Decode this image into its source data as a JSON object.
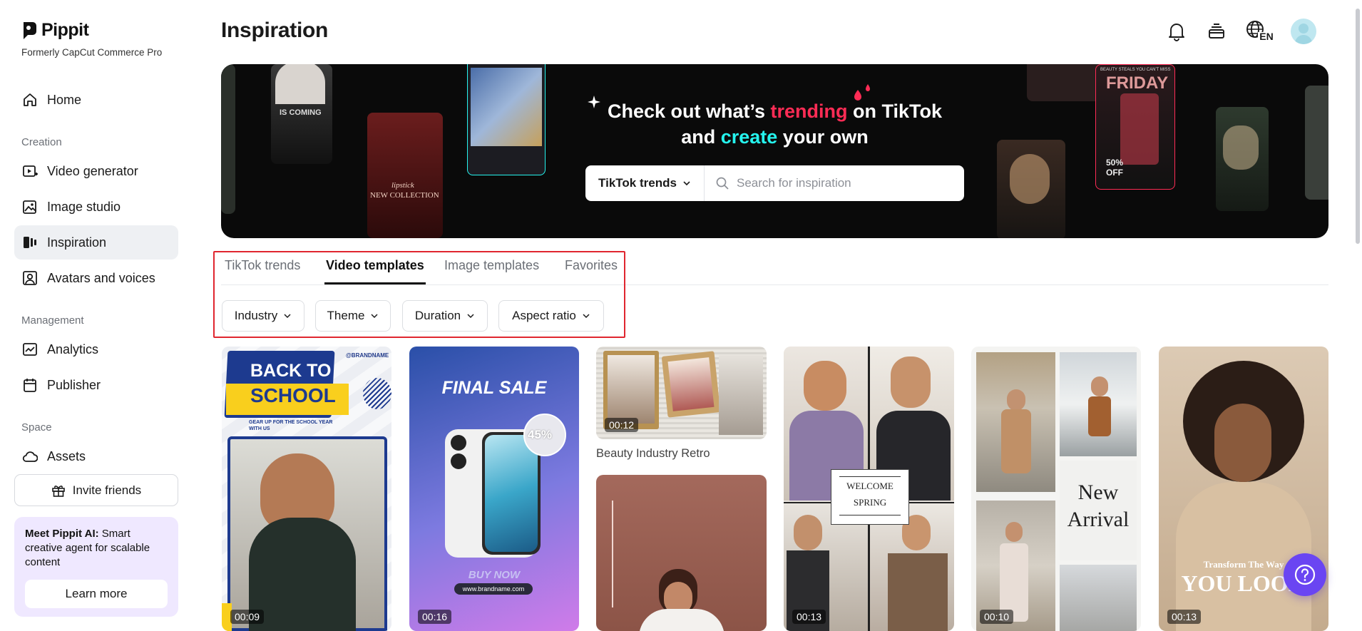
{
  "brand": {
    "name": "Pippit",
    "subtitle": "Formerly CapCut Commerce Pro"
  },
  "sidebar": {
    "home": "Home",
    "sections": {
      "creation": "Creation",
      "management": "Management",
      "space": "Space"
    },
    "items": [
      {
        "label": "Video generator",
        "icon": "video-plus-icon"
      },
      {
        "label": "Image studio",
        "icon": "image-edit-icon"
      },
      {
        "label": "Inspiration",
        "icon": "inspiration-icon",
        "active": true
      },
      {
        "label": "Avatars and voices",
        "icon": "avatar-icon"
      },
      {
        "label": "Analytics",
        "icon": "chart-icon"
      },
      {
        "label": "Publisher",
        "icon": "calendar-icon"
      },
      {
        "label": "Assets",
        "icon": "cloud-icon"
      }
    ],
    "invite": "Invite friends",
    "promo": {
      "bold": "Meet Pippit AI:",
      "text": " Smart creative agent for scalable content",
      "button": "Learn more"
    }
  },
  "header": {
    "title": "Inspiration",
    "icons": [
      "bell-icon",
      "layers-icon",
      "language-icon"
    ],
    "language": "EN"
  },
  "banner": {
    "line1_a": "Check out what’s ",
    "line1_pink": "trending",
    "line1_b": " on TikTok",
    "line2_a": "and ",
    "line2_cyan": "create",
    "line2_b": " your own",
    "select_value": "TikTok trends",
    "search_placeholder": "Search for inspiration",
    "thumb_texts": {
      "is_coming": "IS COMING",
      "lipstick": "lipstick",
      "new_collection": "NEW COLLECTION",
      "beauty_deals": "BEAUTY STEALS YOU CAN'T MISS",
      "friday": "FRIDAY",
      "off": "50%\nOFF"
    }
  },
  "tabs": [
    "TikTok trends",
    "Video templates",
    "Image templates",
    "Favorites"
  ],
  "active_tab": "Video templates",
  "filters": [
    "Industry",
    "Theme",
    "Duration",
    "Aspect ratio"
  ],
  "cards": [
    {
      "duration": "00:09",
      "texts": {
        "brandname": "@BRANDNAME",
        "back": "BACK TO",
        "school": "SCHOOL",
        "gear": "GEAR UP FOR THE SCHOOL YEAR WITH US"
      }
    },
    {
      "duration": "00:16",
      "texts": {
        "final": "FINAL SALE",
        "pct": "45%",
        "buy": "BUY NOW",
        "url": "www.brandname.com"
      }
    },
    {
      "duration": "00:12",
      "title": "Beauty Industry Retro"
    },
    {
      "duration": ""
    },
    {
      "duration": "00:13",
      "texts": {
        "welcome": "WELCOME",
        "spring": "SPRING"
      }
    },
    {
      "duration": "00:10",
      "texts": {
        "new": "New",
        "arrival": "Arrival"
      }
    },
    {
      "duration": "00:13",
      "texts": {
        "transform": "Transform The Way",
        "you": "YOU LOOK"
      }
    }
  ],
  "colors": {
    "accent": "#6a45f2",
    "highlight": "#e0262f",
    "tiktok_pink": "#fe2c55",
    "tiktok_cyan": "#25f4ee"
  }
}
